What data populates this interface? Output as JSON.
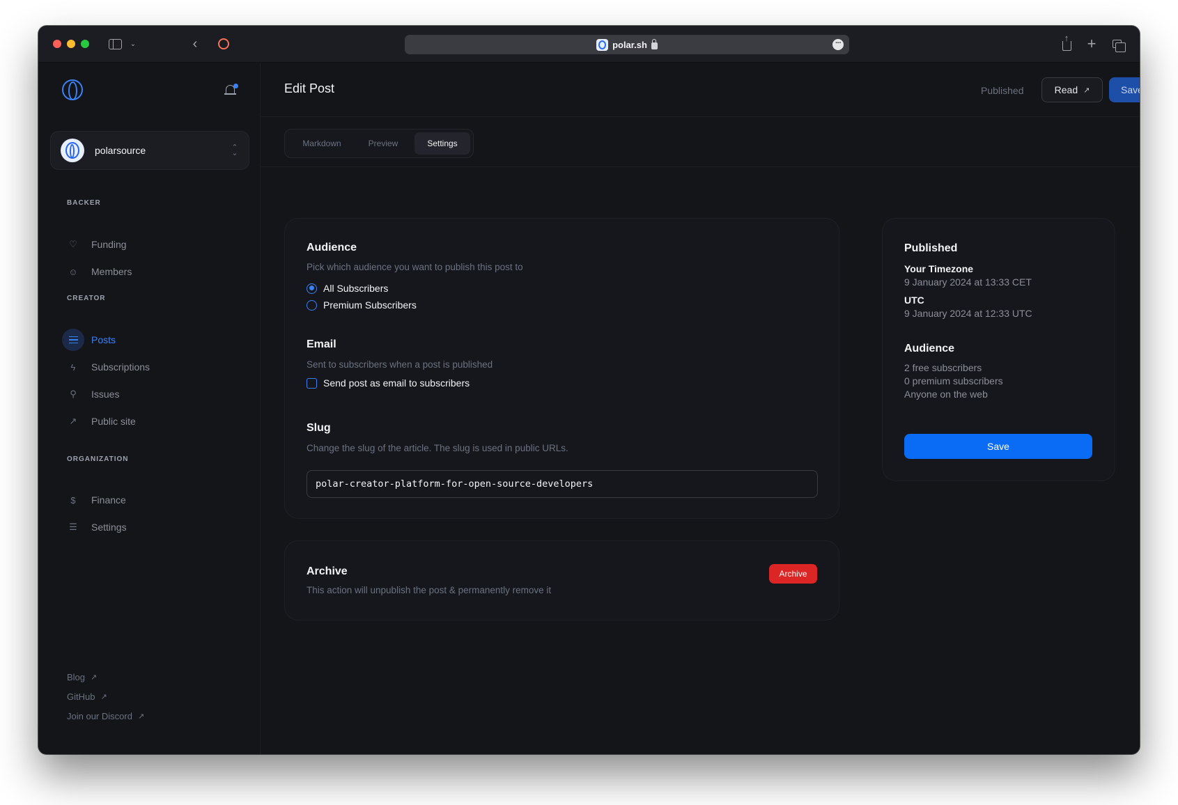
{
  "browser": {
    "url": "polar.sh",
    "icons": [
      "sidebar-toggle-icon",
      "chevron-down-icon",
      "back-icon",
      "extension-icon",
      "lock-icon",
      "more-icon",
      "share-icon",
      "new-tab-icon",
      "tabs-overview-icon"
    ]
  },
  "sidebar": {
    "org_name": "polarsource",
    "sections": {
      "backer": "BACKER",
      "creator": "CREATOR",
      "organization": "ORGANIZATION"
    },
    "items": [
      {
        "label": "Funding",
        "icon": "heart-icon"
      },
      {
        "label": "Members",
        "icon": "face-icon"
      },
      {
        "label": "Posts",
        "icon": "posts-icon",
        "active": true
      },
      {
        "label": "Subscriptions",
        "icon": "bolt-icon"
      },
      {
        "label": "Issues",
        "icon": "stamp-icon"
      },
      {
        "label": "Public site",
        "icon": "arrow-up-right-icon"
      },
      {
        "label": "Finance",
        "icon": "dollar-icon"
      },
      {
        "label": "Settings",
        "icon": "sliders-icon"
      }
    ],
    "footer": [
      {
        "label": "Blog"
      },
      {
        "label": "GitHub"
      },
      {
        "label": "Join our Discord"
      }
    ]
  },
  "header": {
    "title": "Edit Post",
    "status": "Published",
    "read_label": "Read",
    "save_label": "Save"
  },
  "tabs": [
    {
      "label": "Markdown"
    },
    {
      "label": "Preview"
    },
    {
      "label": "Settings",
      "active": true
    }
  ],
  "settings": {
    "audience": {
      "title": "Audience",
      "description": "Pick which audience you want to publish this post to",
      "options": [
        {
          "label": "All Subscribers",
          "checked": true
        },
        {
          "label": "Premium Subscribers",
          "checked": false
        }
      ]
    },
    "email": {
      "title": "Email",
      "description": "Sent to subscribers when a post is published",
      "checkbox_label": "Send post as email to subscribers",
      "checked": false
    },
    "slug": {
      "title": "Slug",
      "description": "Change the slug of the article. The slug is used in public URLs.",
      "value": "polar-creator-platform-for-open-source-developers"
    },
    "archive": {
      "title": "Archive",
      "description": "This action will unpublish the post & permanently remove it",
      "button_label": "Archive"
    }
  },
  "side_panel": {
    "published_title": "Published",
    "your_tz_label": "Your Timezone",
    "your_tz_value": "9 January 2024 at 13:33 CET",
    "utc_label": "UTC",
    "utc_value": "9 January 2024 at 12:33 UTC",
    "audience_title": "Audience",
    "audience_lines": [
      "2 free subscribers",
      "0 premium subscribers",
      "Anyone on the web"
    ],
    "save_label": "Save"
  },
  "colors": {
    "accent": "#3b82f6",
    "primary_button": "#0a6cf5",
    "danger": "#dc2626",
    "background": "#141519"
  }
}
